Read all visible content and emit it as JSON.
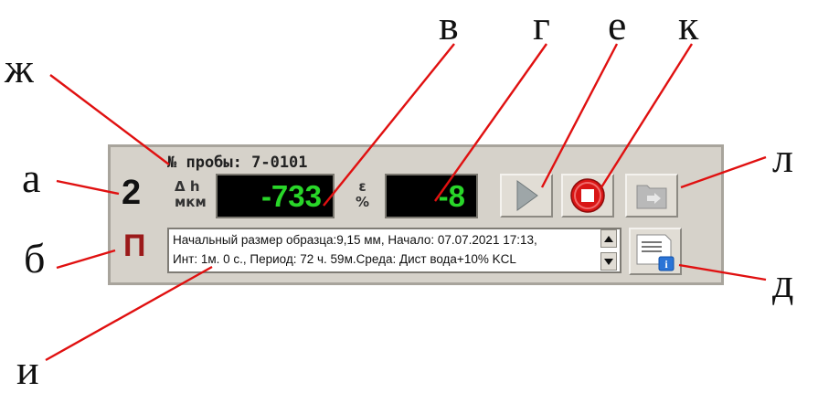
{
  "callouts": {
    "a": "а",
    "b": "б",
    "v": "в",
    "g": "г",
    "e": "е",
    "k": "к",
    "l": "л",
    "d": "д",
    "i": "и",
    "zh": "ж"
  },
  "panel": {
    "channel_number": "2",
    "mode_letter": "П",
    "sample_label": "№ пробы: 7-0101",
    "dh_label_top": "Δ h",
    "dh_label_bottom": "мкм",
    "dh_value": "-733",
    "eps_label_top": "ε",
    "eps_label_bottom": "%",
    "eps_value": "-8",
    "info_line_1": "Начальный размер образца:9,15 мм, Начало:  07.07.2021 17:13,",
    "info_line_2": "Инт: 1м. 0 с., Период:  72 ч. 59м.Среда:   Дист вода+10% KCL"
  },
  "icons": {
    "play": "play-icon",
    "stop": "stop-icon",
    "export": "folder-export-icon",
    "info": "document-info-icon",
    "scroll_up": "arrow-up-icon",
    "scroll_down": "arrow-down-icon"
  },
  "colors": {
    "lcd_text": "#29d629",
    "mode_letter": "#9b1a1a",
    "callout_lines": "#e01010",
    "stop_button": "#d91515"
  }
}
